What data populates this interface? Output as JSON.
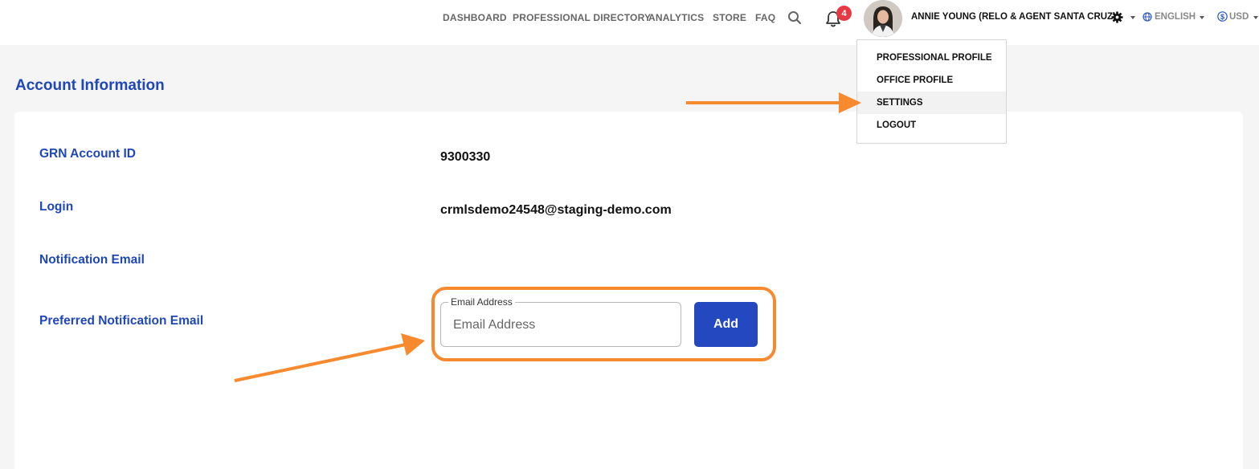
{
  "nav": {
    "links": [
      "DASHBOARD",
      "PROFESSIONAL DIRECTORY",
      "ANALYTICS",
      "STORE",
      "FAQ"
    ],
    "notification_count": "4",
    "user_name": "ANNIE YOUNG (RELO & AGENT SANTA CRUZ)",
    "language": "ENGLISH",
    "currency": "USD"
  },
  "dropdown": {
    "items": [
      "PROFESSIONAL PROFILE",
      "OFFICE PROFILE",
      "SETTINGS",
      "LOGOUT"
    ],
    "active": "SETTINGS"
  },
  "page": {
    "title": "Account Information"
  },
  "account": {
    "grn_label": "GRN Account ID",
    "grn_value": "9300330",
    "login_label": "Login",
    "login_value": "crmlsdemo24548@staging-demo.com",
    "notification_email_label": "Notification Email",
    "preferred_email_label": "Preferred Notification Email"
  },
  "email_form": {
    "legend": "Email Address",
    "placeholder": "Email Address",
    "value": "",
    "add_label": "Add"
  },
  "colors": {
    "accent_blue": "#2047b8",
    "button_blue": "#2448bf",
    "annotation_orange": "#f7892f",
    "badge_red": "#e53945"
  },
  "icons": [
    "search-icon",
    "bell-icon",
    "gear-icon",
    "globe-icon",
    "dollar-icon",
    "chevron-down-icon"
  ]
}
